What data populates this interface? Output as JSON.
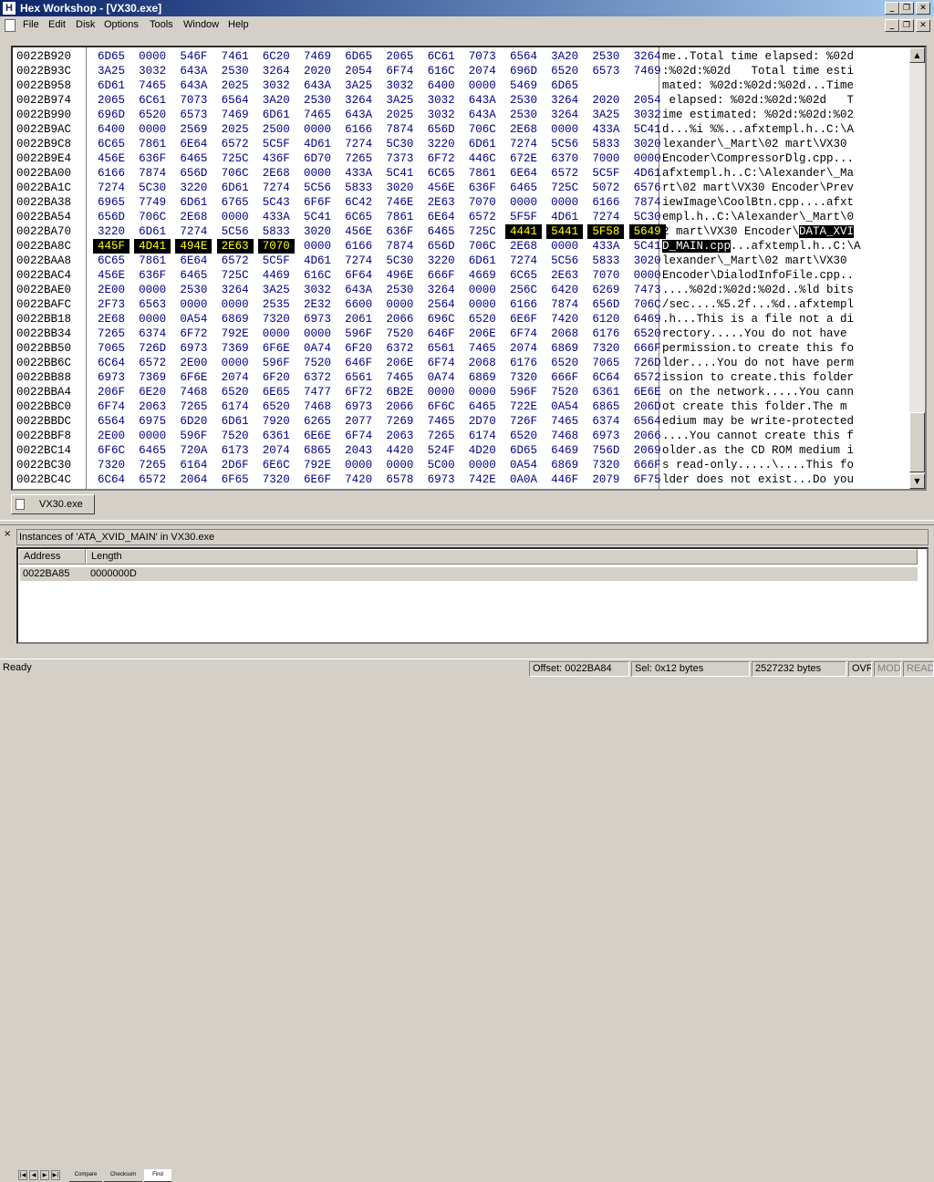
{
  "window": {
    "title": "Hex Workshop - [VX30.exe]",
    "app_icon": "H",
    "colors": {
      "title_bar_start": "#0a246a",
      "title_bar_end": "#a6caf0",
      "hex_text": "#00008b",
      "selection_bg": "#000000",
      "selection_hex_fg": "#ffff00"
    }
  },
  "menu": [
    "File",
    "Edit",
    "Disk",
    "Options",
    "Tools",
    "Window",
    "Help"
  ],
  "hex": {
    "rows": [
      {
        "addr": "0022B920",
        "words": [
          "6D65",
          "0000",
          "546F",
          "7461",
          "6C20",
          "7469",
          "6D65",
          "2065",
          "6C61",
          "7073",
          "6564",
          "3A20",
          "2530",
          "3264"
        ],
        "ascii": "me..Total time elapsed: %02d"
      },
      {
        "addr": "0022B93C",
        "words": [
          "3A25",
          "3032",
          "643A",
          "2530",
          "3264",
          "2020",
          "2054",
          "6F74",
          "616C",
          "2074",
          "696D",
          "6520",
          "6573",
          "7469"
        ],
        "ascii": ":%02d:%02d   Total time esti"
      },
      {
        "addr": "0022B958",
        "words": [
          "6D61",
          "7465",
          "643A",
          "2025",
          "3032",
          "643A",
          "3A25",
          "3032",
          "6400",
          "0000",
          "5469",
          "6D65"
        ],
        "ascii": "mated: %02d:%02d:%02d...Time"
      },
      {
        "addr": "0022B974",
        "words": [
          "2065",
          "6C61",
          "7073",
          "6564",
          "3A20",
          "2530",
          "3264",
          "3A25",
          "3032",
          "643A",
          "2530",
          "3264",
          "2020",
          "2054"
        ],
        "ascii": " elapsed: %02d:%02d:%02d   T"
      },
      {
        "addr": "0022B990",
        "words": [
          "696D",
          "6520",
          "6573",
          "7469",
          "6D61",
          "7465",
          "643A",
          "2025",
          "3032",
          "643A",
          "2530",
          "3264",
          "3A25",
          "3032"
        ],
        "ascii": "ime estimated: %02d:%02d:%02"
      },
      {
        "addr": "0022B9AC",
        "words": [
          "6400",
          "0000",
          "2569",
          "2025",
          "2500",
          "0000",
          "6166",
          "7874",
          "656D",
          "706C",
          "2E68",
          "0000",
          "433A",
          "5C41"
        ],
        "ascii": "d...%i %%...afxtempl.h..C:\\A"
      },
      {
        "addr": "0022B9C8",
        "words": [
          "6C65",
          "7861",
          "6E64",
          "6572",
          "5C5F",
          "4D61",
          "7274",
          "5C30",
          "3220",
          "6D61",
          "7274",
          "5C56",
          "5833",
          "3020"
        ],
        "ascii": "lexander\\_Mart\\02 mart\\VX30 "
      },
      {
        "addr": "0022B9E4",
        "words": [
          "456E",
          "636F",
          "6465",
          "725C",
          "436F",
          "6D70",
          "7265",
          "7373",
          "6F72",
          "446C",
          "672E",
          "6370",
          "7000",
          "0000"
        ],
        "ascii": "Encoder\\CompressorDlg.cpp..."
      },
      {
        "addr": "0022BA00",
        "words": [
          "6166",
          "7874",
          "656D",
          "706C",
          "2E68",
          "0000",
          "433A",
          "5C41",
          "6C65",
          "7861",
          "6E64",
          "6572",
          "5C5F",
          "4D61"
        ],
        "ascii": "afxtempl.h..C:\\Alexander\\_Ma"
      },
      {
        "addr": "0022BA1C",
        "words": [
          "7274",
          "5C30",
          "3220",
          "6D61",
          "7274",
          "5C56",
          "5833",
          "3020",
          "456E",
          "636F",
          "6465",
          "725C",
          "5072",
          "6576"
        ],
        "ascii": "rt\\02 mart\\VX30 Encoder\\Prev"
      },
      {
        "addr": "0022BA38",
        "words": [
          "6965",
          "7749",
          "6D61",
          "6765",
          "5C43",
          "6F6F",
          "6C42",
          "746E",
          "2E63",
          "7070",
          "0000",
          "0000",
          "6166",
          "7874"
        ],
        "ascii": "iewImage\\CoolBtn.cpp....afxt"
      },
      {
        "addr": "0022BA54",
        "words": [
          "656D",
          "706C",
          "2E68",
          "0000",
          "433A",
          "5C41",
          "6C65",
          "7861",
          "6E64",
          "6572",
          "5F5F",
          "4D61",
          "7274",
          "5C30"
        ],
        "ascii": "empl.h..C:\\Alexander\\_Mart\\0"
      },
      {
        "addr": "0022BA70",
        "words": [
          "3220",
          "6D61",
          "7274",
          "5C56",
          "5833",
          "3020",
          "456E",
          "636F",
          "6465",
          "725C",
          "4441",
          "5441",
          "5F58",
          "5649"
        ],
        "ascii_pre": "2 mart\\VX30 Encoder\\",
        "ascii_sel": "DATA_XVI",
        "ascii_post": "",
        "sel_from": 10
      },
      {
        "addr": "0022BA8C",
        "words": [
          "445F",
          "4D41",
          "494E",
          "2E63",
          "7070",
          "0000",
          "6166",
          "7874",
          "656D",
          "706C",
          "2E68",
          "0000",
          "433A",
          "5C41"
        ],
        "ascii_pre": "",
        "ascii_sel": "D_MAIN.cpp",
        "ascii_post": "...afxtempl.h..C:\\A",
        "sel_to": 5
      },
      {
        "addr": "0022BAA8",
        "words": [
          "6C65",
          "7861",
          "6E64",
          "6572",
          "5C5F",
          "4D61",
          "7274",
          "5C30",
          "3220",
          "6D61",
          "7274",
          "5C56",
          "5833",
          "3020"
        ],
        "ascii": "lexander\\_Mart\\02 mart\\VX30 "
      },
      {
        "addr": "0022BAC4",
        "words": [
          "456E",
          "636F",
          "6465",
          "725C",
          "4469",
          "616C",
          "6F64",
          "496E",
          "666F",
          "4669",
          "6C65",
          "2E63",
          "7070",
          "0000"
        ],
        "ascii": "Encoder\\DialodInfoFile.cpp.."
      },
      {
        "addr": "0022BAE0",
        "words": [
          "2E00",
          "0000",
          "2530",
          "3264",
          "3A25",
          "3032",
          "643A",
          "2530",
          "3264",
          "0000",
          "256C",
          "6420",
          "6269",
          "7473"
        ],
        "ascii": "....%02d:%02d:%02d..%ld bits"
      },
      {
        "addr": "0022BAFC",
        "words": [
          "2F73",
          "6563",
          "0000",
          "0000",
          "2535",
          "2E32",
          "6600",
          "0000",
          "2564",
          "0000",
          "6166",
          "7874",
          "656D",
          "706C"
        ],
        "ascii": "/sec....%5.2f...%d..afxtempl"
      },
      {
        "addr": "0022BB18",
        "words": [
          "2E68",
          "0000",
          "0A54",
          "6869",
          "7320",
          "6973",
          "2061",
          "2066",
          "696C",
          "6520",
          "6E6F",
          "7420",
          "6120",
          "6469"
        ],
        "ascii": ".h...This is a file not a di"
      },
      {
        "addr": "0022BB34",
        "words": [
          "7265",
          "6374",
          "6F72",
          "792E",
          "0000",
          "0000",
          "596F",
          "7520",
          "646F",
          "206E",
          "6F74",
          "2068",
          "6176",
          "6520"
        ],
        "ascii": "rectory.....You do not have "
      },
      {
        "addr": "0022BB50",
        "words": [
          "7065",
          "726D",
          "6973",
          "7369",
          "6F6E",
          "0A74",
          "6F20",
          "6372",
          "6561",
          "7465",
          "2074",
          "6869",
          "7320",
          "666F"
        ],
        "ascii": "permission.to create this fo"
      },
      {
        "addr": "0022BB6C",
        "words": [
          "6C64",
          "6572",
          "2E00",
          "0000",
          "596F",
          "7520",
          "646F",
          "206E",
          "6F74",
          "2068",
          "6176",
          "6520",
          "7065",
          "726D"
        ],
        "ascii": "lder....You do not have perm"
      },
      {
        "addr": "0022BB88",
        "words": [
          "6973",
          "7369",
          "6F6E",
          "2074",
          "6F20",
          "6372",
          "6561",
          "7465",
          "0A74",
          "6869",
          "7320",
          "666F",
          "6C64",
          "6572"
        ],
        "ascii": "ission to create.this folder"
      },
      {
        "addr": "0022BBA4",
        "words": [
          "206F",
          "6E20",
          "7468",
          "6520",
          "6E65",
          "7477",
          "6F72",
          "6B2E",
          "0000",
          "0000",
          "596F",
          "7520",
          "6361",
          "6E6E"
        ],
        "ascii": " on the network.....You cann"
      },
      {
        "addr": "0022BBC0",
        "words": [
          "6F74",
          "2063",
          "7265",
          "6174",
          "6520",
          "7468",
          "6973",
          "2066",
          "6F6C",
          "6465",
          "722E",
          "0A54",
          "6865",
          "206D"
        ],
        "ascii": "ot create this folder.The m"
      },
      {
        "addr": "0022BBDC",
        "words": [
          "6564",
          "6975",
          "6D20",
          "6D61",
          "7920",
          "6265",
          "2077",
          "7269",
          "7465",
          "2D70",
          "726F",
          "7465",
          "6374",
          "6564"
        ],
        "ascii": "edium may be write-protected"
      },
      {
        "addr": "0022BBF8",
        "words": [
          "2E00",
          "0000",
          "596F",
          "7520",
          "6361",
          "6E6E",
          "6F74",
          "2063",
          "7265",
          "6174",
          "6520",
          "7468",
          "6973",
          "2066"
        ],
        "ascii": "....You cannot create this f"
      },
      {
        "addr": "0022BC14",
        "words": [
          "6F6C",
          "6465",
          "720A",
          "6173",
          "2074",
          "6865",
          "2043",
          "4420",
          "524F",
          "4D20",
          "6D65",
          "6469",
          "756D",
          "2069"
        ],
        "ascii": "older.as the CD ROM medium i"
      },
      {
        "addr": "0022BC30",
        "words": [
          "7320",
          "7265",
          "6164",
          "2D6F",
          "6E6C",
          "792E",
          "0000",
          "0000",
          "5C00",
          "0000",
          "0A54",
          "6869",
          "7320",
          "666F"
        ],
        "ascii": "s read-only.....\\....This fo"
      },
      {
        "addr": "0022BC4C",
        "words": [
          "6C64",
          "6572",
          "2064",
          "6F65",
          "7320",
          "6E6F",
          "7420",
          "6578",
          "6973",
          "742E",
          "0A0A",
          "446F",
          "2079",
          "6F75"
        ],
        "ascii": "lder does not exist...Do you"
      }
    ]
  },
  "doc_tab": {
    "label": "VX30.exe"
  },
  "find_panel": {
    "title": "Instances of 'ATA_XVID_MAIN' in VX30.exe",
    "columns": [
      "Address",
      "Length"
    ],
    "results": [
      {
        "address": "0022BA85",
        "length": "0000000D"
      }
    ],
    "tabs": [
      "Compare",
      "Checksum",
      "Find"
    ],
    "close_glyph": "×"
  },
  "status": {
    "ready": "Ready",
    "offset": "Offset: 0022BA84",
    "selection": "Sel: 0x12 bytes",
    "size": "2527232 bytes",
    "ovr": "OVR",
    "mod": "MOD",
    "read": "READ"
  }
}
